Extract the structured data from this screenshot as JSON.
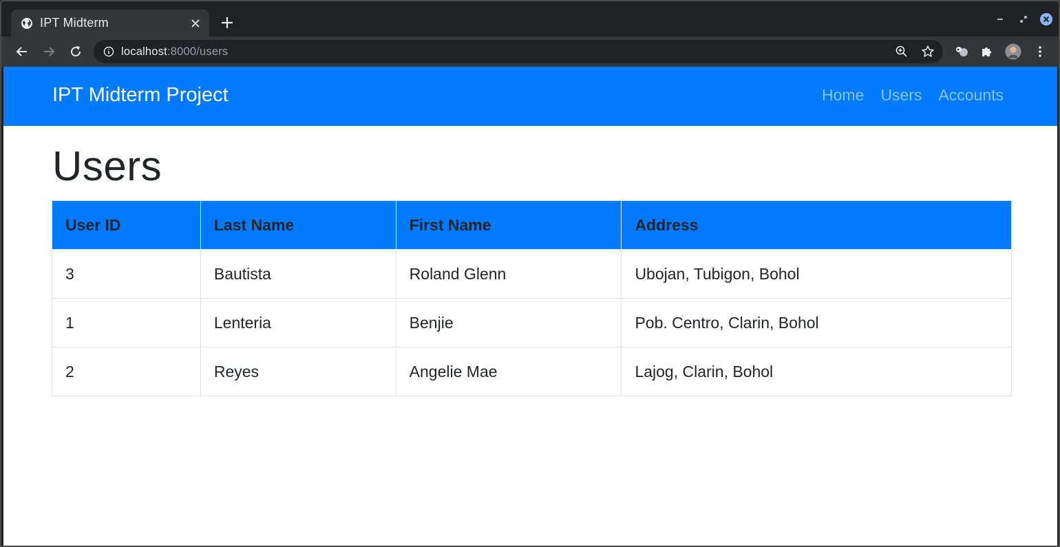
{
  "browser": {
    "tab_title": "IPT Midterm",
    "url_host": "localhost",
    "url_path": ":8000/users"
  },
  "navbar": {
    "brand": "IPT Midterm Project",
    "links": [
      "Home",
      "Users",
      "Accounts"
    ],
    "color": "#007bff"
  },
  "main": {
    "title": "Users",
    "table": {
      "headers": [
        "User ID",
        "Last Name",
        "First Name",
        "Address"
      ],
      "rows": [
        [
          "3",
          "Bautista",
          "Roland Glenn",
          "Ubojan, Tubigon, Bohol"
        ],
        [
          "1",
          "Lenteria",
          "Benjie",
          "Pob. Centro, Clarin, Bohol"
        ],
        [
          "2",
          "Reyes",
          "Angelie Mae",
          "Lajog, Clarin, Bohol"
        ]
      ]
    }
  }
}
